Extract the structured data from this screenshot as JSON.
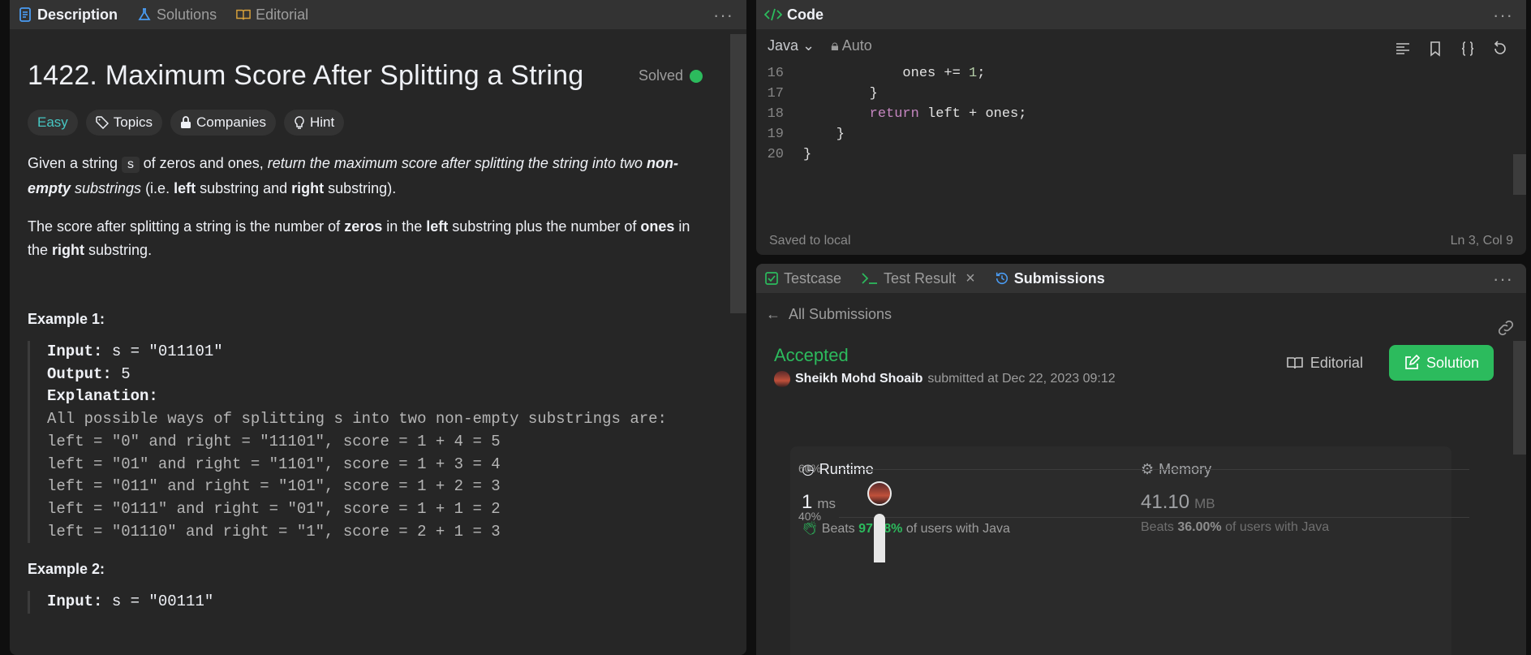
{
  "left_tabs": [
    {
      "label": "Description",
      "icon": "document-icon"
    },
    {
      "label": "Solutions",
      "icon": "flask-icon"
    },
    {
      "label": "Editorial",
      "icon": "book-icon"
    }
  ],
  "problem": {
    "title": "1422. Maximum Score After Splitting a String",
    "solved_label": "Solved",
    "difficulty": "Easy",
    "tags": [
      "Topics",
      "Companies",
      "Hint"
    ]
  },
  "description": {
    "p1_a": "Given a string ",
    "p1_code": "s",
    "p1_b": " of zeros and ones, ",
    "p1_ital": "return the maximum score after splitting the string into two ",
    "p1_bold_ital": "non-empty",
    "p1_ital2": " substrings",
    "p1_c": " (i.e. ",
    "p1_left": "left",
    "p1_d": " substring and ",
    "p1_right": "right",
    "p1_e": " substring).",
    "p2_a": "The score after splitting a string is the number of ",
    "p2_zeros": "zeros",
    "p2_b": " in the ",
    "p2_left": "left",
    "p2_c": " substring plus the number of ",
    "p2_ones": "ones",
    "p2_d": " in the ",
    "p2_right": "right",
    "p2_e": " substring."
  },
  "example1": {
    "heading": "Example 1:",
    "input_label": "Input:",
    "input_value": " s = \"011101\"",
    "output_label": "Output:",
    "output_value": " 5",
    "explanation_label": "Explanation:",
    "lines": [
      "All possible ways of splitting s into two non-empty substrings are:",
      "left = \"0\" and right = \"11101\", score = 1 + 4 = 5",
      "left = \"01\" and right = \"1101\", score = 1 + 3 = 4",
      "left = \"011\" and right = \"101\", score = 1 + 2 = 3",
      "left = \"0111\" and right = \"01\", score = 1 + 1 = 2",
      "left = \"01110\" and right = \"1\", score = 2 + 1 = 3"
    ]
  },
  "example2": {
    "heading": "Example 2:",
    "input_label": "Input:",
    "input_value": " s = \"00111\""
  },
  "code_panel": {
    "title": "Code",
    "language": "Java",
    "mode": "Auto",
    "lines": [
      {
        "n": "16",
        "text": "            ones += 1;"
      },
      {
        "n": "17",
        "text": "        }"
      },
      {
        "n": "18",
        "text": "        return left + ones;"
      },
      {
        "n": "19",
        "text": "    }"
      },
      {
        "n": "20",
        "text": "}"
      }
    ],
    "saved": "Saved to local",
    "cursor": "Ln 3, Col 9"
  },
  "result_tabs": [
    {
      "label": "Testcase",
      "icon": "checkbox-icon"
    },
    {
      "label": "Test Result",
      "icon": "terminal-icon"
    },
    {
      "label": "Submissions",
      "icon": "history-icon"
    }
  ],
  "submission": {
    "back_label": "All Submissions",
    "status": "Accepted",
    "user": "Sheikh Mohd Shoaib",
    "submitted": "submitted at Dec 22, 2023 09:12",
    "editorial_btn": "Editorial",
    "solution_btn": "Solution",
    "runtime": {
      "label": "Runtime",
      "value": "1",
      "unit": "ms",
      "beats_pre": "Beats ",
      "beats": "97.78%",
      "beats_post": " of users with Java"
    },
    "memory": {
      "label": "Memory",
      "value": "41.10",
      "unit": "MB",
      "beats_pre": "Beats ",
      "beats": "36.00%",
      "beats_post": " of users with Java"
    },
    "axis": [
      "60%",
      "40%"
    ]
  },
  "colors": {
    "accent_green": "#2cbb5d",
    "easy": "#46c6c2"
  }
}
